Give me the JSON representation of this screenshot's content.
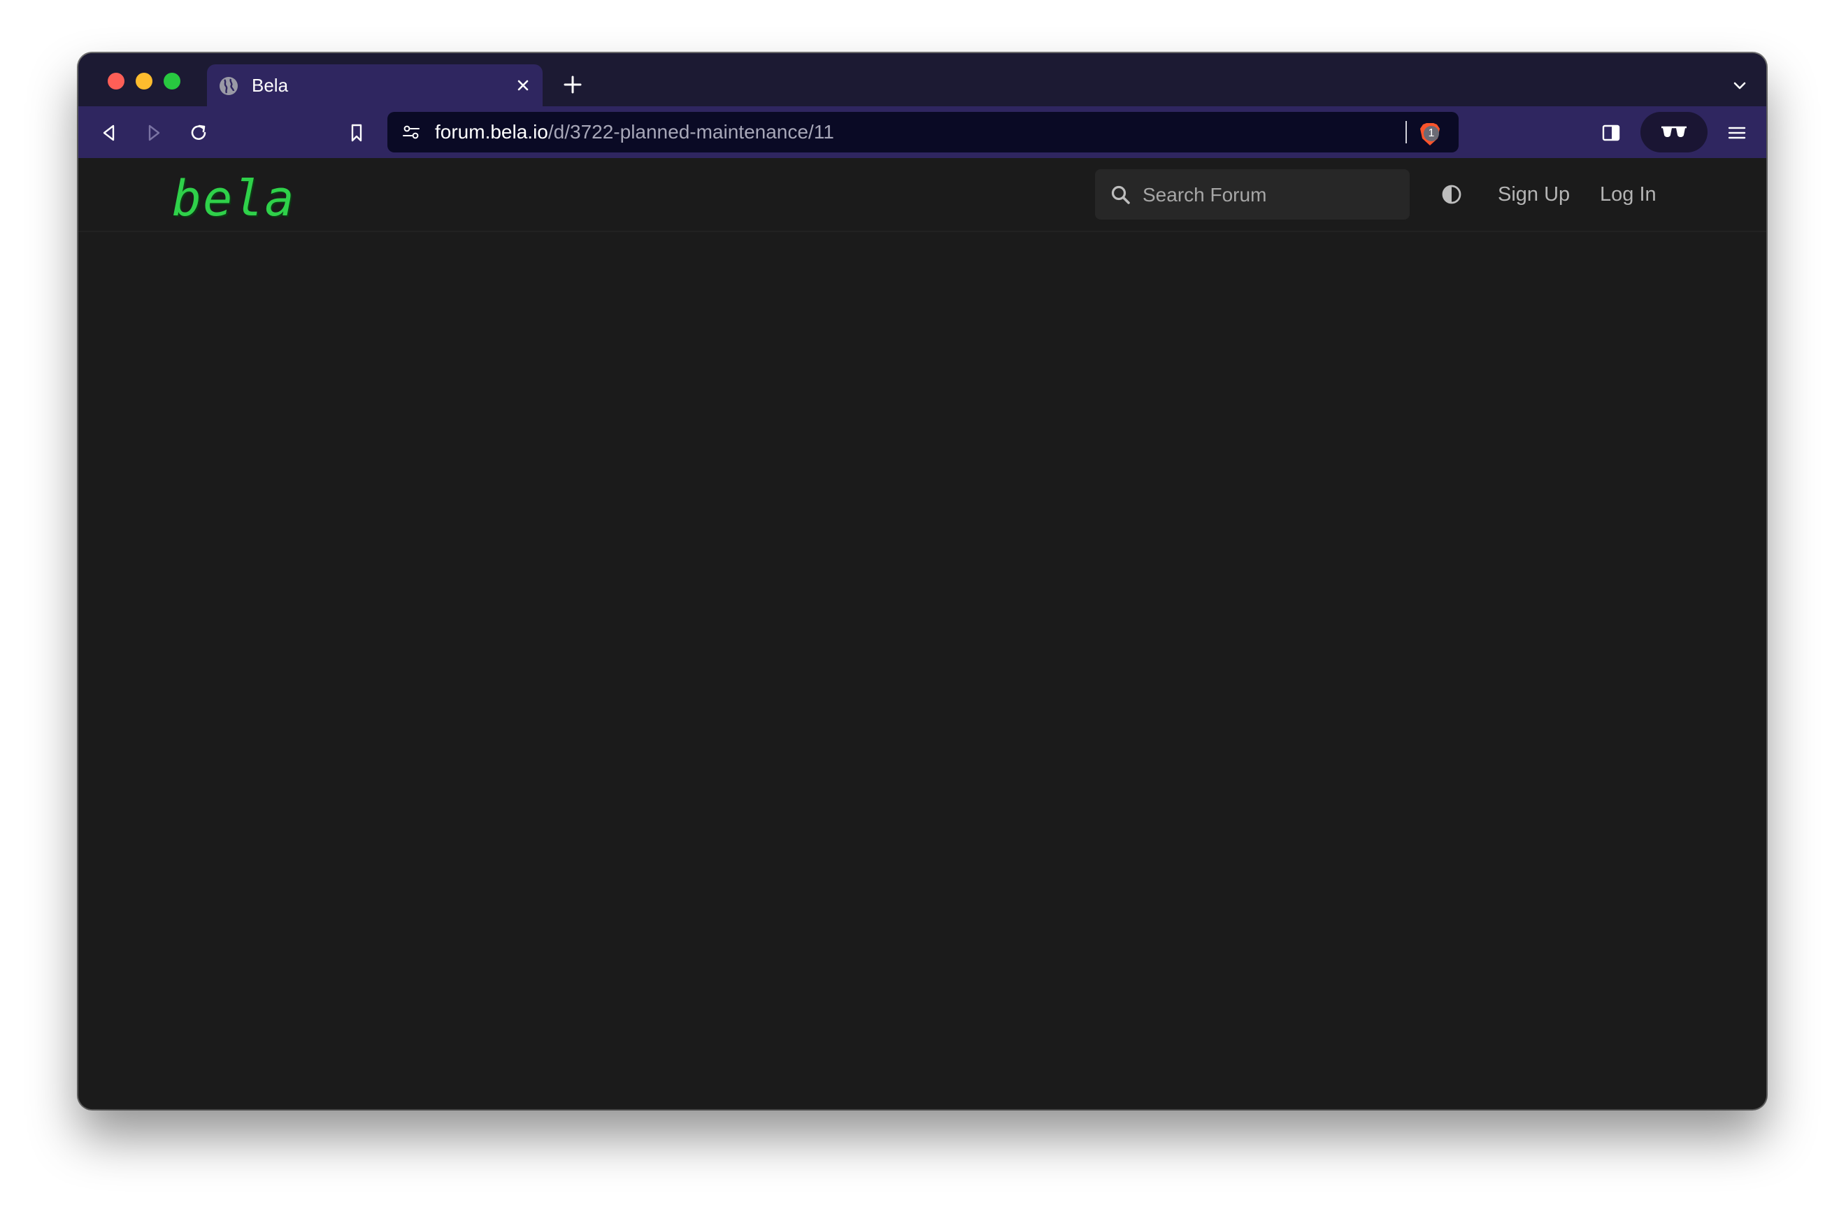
{
  "browser": {
    "tab": {
      "title": "Bela",
      "icon": "globe-icon"
    },
    "address_bar": {
      "host": "forum.bela.io",
      "path": "/d/3722-planned-maintenance/11"
    },
    "shields_badge_count": "1",
    "colors": {
      "tab_strip": "#1c1a33",
      "toolbar": "#2f2660",
      "url_bar": "#0a0a25"
    }
  },
  "site": {
    "logo_text": "bela",
    "search": {
      "placeholder": "Search Forum"
    },
    "nav": {
      "sign_up": "Sign Up",
      "log_in": "Log In"
    },
    "colors": {
      "logo": "#2fd14a",
      "background": "#1b1b1b",
      "search_bg": "#272727"
    }
  }
}
